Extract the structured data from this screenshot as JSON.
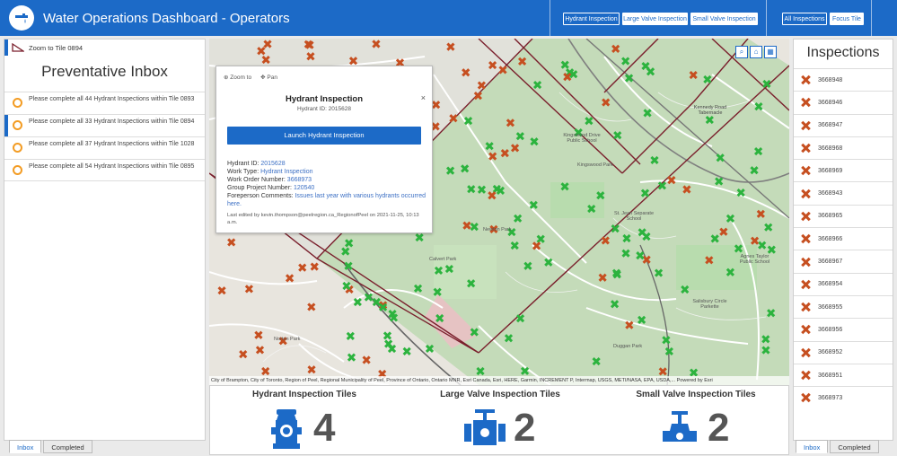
{
  "header": {
    "title": "Water Operations Dashboard - Operators",
    "filter_buttons": [
      "Hydrant Inspection",
      "Large Valve Inspection",
      "Small Valve Inspection"
    ],
    "view_buttons": [
      "All Inspections",
      "Focus Tile"
    ]
  },
  "left_panel": {
    "zoom_label": "Zoom to Tile 0894",
    "title": "Preventative Inbox",
    "items": [
      {
        "text": "Please complete all 44 Hydrant Inspections within Tile 0893"
      },
      {
        "text": "Please complete all 33 Hydrant Inspections within Tile 0894"
      },
      {
        "text": "Please complete all 37 Hydrant Inspections within Tile 1028"
      },
      {
        "text": "Please complete all 54 Hydrant Inspections within Tile 0895"
      }
    ],
    "tabs": [
      "Inbox",
      "Completed"
    ]
  },
  "popup": {
    "zoom_to": "Zoom to",
    "pan": "Pan",
    "close": "×",
    "title": "Hydrant Inspection",
    "subtitle": "Hydrant ID: 2015628",
    "launch": "Launch Hydrant Inspection",
    "fields": {
      "hydrant_id_label": "Hydrant ID:",
      "hydrant_id": "2015628",
      "work_type_label": "Work Type:",
      "work_type": "Hydrant Inspection",
      "work_order_label": "Work Order Number:",
      "work_order": "3668973",
      "group_label": "Group Project Number:",
      "group": "120540",
      "comments_label": "Foreperson Comments:",
      "comments": "Issues last year with various hydrants occurred here."
    },
    "edited": "Last edited by kevin.thompson@peelregion.ca_RegionofPeel on 2021-11-25, 10:13 a.m."
  },
  "map": {
    "attribution": "City of Brampton, City of Toronto, Region of Peel, Regional Municipality of Peel, Province of Ontario, Ontario MNR, Esri Canada, Esri, HERE, Garmin, INCREMENT P, Intermap, USGS, METI/NASA, EPA, USDA,...   Powered by Esri",
    "labels": [
      "Kingswood Drive Public School",
      "Kingswood Park",
      "Newton Park",
      "Calvert Park",
      "St. Jean Separate School",
      "Agnes Taylor Public School",
      "Salisbury Circle Parkette",
      "Duggan Park",
      "Norton Park",
      "Kennedy Road Tabernacle"
    ]
  },
  "tiles": [
    {
      "title": "Hydrant Inspection Tiles",
      "count": "4"
    },
    {
      "title": "Large Valve Inspection Tiles",
      "count": "2"
    },
    {
      "title": "Small Valve Inspection Tiles",
      "count": "2"
    }
  ],
  "right_panel": {
    "title": "Inspections",
    "items": [
      "3668948",
      "3668946",
      "3668947",
      "3668968",
      "3668969",
      "3668943",
      "3668965",
      "3668966",
      "3668967",
      "3668954",
      "3668955",
      "3668956",
      "3668952",
      "3668951",
      "3668973"
    ],
    "tabs": [
      "Inbox",
      "Completed"
    ]
  },
  "colors": {
    "accent": "#1c6ac7",
    "orange_marker": "#c64f20",
    "green_marker": "#2cb33e",
    "inbox_circle": "#f39c24"
  }
}
